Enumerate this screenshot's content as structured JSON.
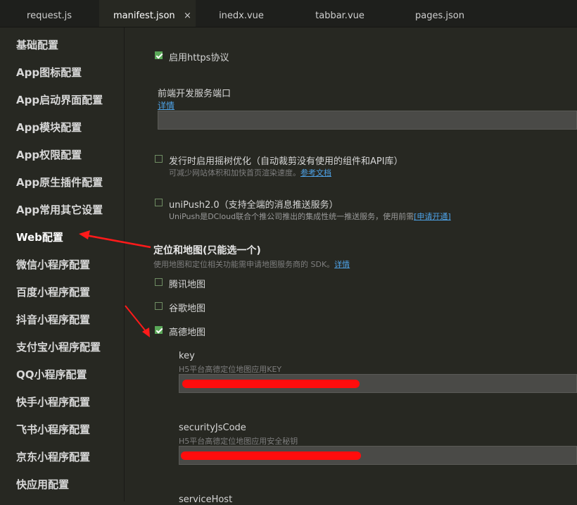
{
  "tabs": [
    {
      "label": "request.js",
      "active": false
    },
    {
      "label": "manifest.json",
      "active": true
    },
    {
      "label": "inedx.vue",
      "active": false
    },
    {
      "label": "tabbar.vue",
      "active": false
    },
    {
      "label": "pages.json",
      "active": false
    }
  ],
  "close_glyph": "×",
  "sidebar": {
    "items": [
      "基础配置",
      "App图标配置",
      "App启动界面配置",
      "App模块配置",
      "App权限配置",
      "App原生插件配置",
      "App常用其它设置",
      "Web配置",
      "微信小程序配置",
      "百度小程序配置",
      "抖音小程序配置",
      "支付宝小程序配置",
      "QQ小程序配置",
      "快手小程序配置",
      "飞书小程序配置",
      "京东小程序配置",
      "快应用配置"
    ],
    "active_index": 7
  },
  "main": {
    "https": {
      "label": "启用https协议",
      "checked": true
    },
    "devserver": {
      "label": "前端开发服务端口",
      "link": "详情",
      "value": ""
    },
    "treeshake": {
      "label": "发行时启用摇树优化（自动裁剪没有使用的组件和API库）",
      "checked": false,
      "hint": "可减少网站体积和加快首页渲染速度。",
      "link": "参考文档"
    },
    "unipush": {
      "label": "uniPush2.0（支持全端的消息推送服务）",
      "checked": false,
      "hint": "UniPush是DCloud联合个推公司推出的集成性统一推送服务，使用前需",
      "link": "[申请开通]"
    },
    "map": {
      "heading": "定位和地图(只能选一个)",
      "hint": "使用地图和定位相关功能需申请地图服务商的 SDK。",
      "link": "详情",
      "options": [
        {
          "label": "腾讯地图",
          "checked": false
        },
        {
          "label": "谷歌地图",
          "checked": false
        },
        {
          "label": "高德地图",
          "checked": true
        }
      ]
    },
    "key": {
      "label": "key",
      "hint": "H5平台高德定位地图应用KEY",
      "value": ""
    },
    "securityJsCode": {
      "label": "securityJsCode",
      "hint": "H5平台高德定位地图应用安全秘钥",
      "value": ""
    },
    "serviceHost": {
      "label": "serviceHost"
    }
  },
  "colors": {
    "background": "#272822",
    "tabbar": "#1e1f1c",
    "checkbox_checked": "#5aa858",
    "link": "#4ea3e8",
    "annotation_red": "#ff0d0d"
  }
}
